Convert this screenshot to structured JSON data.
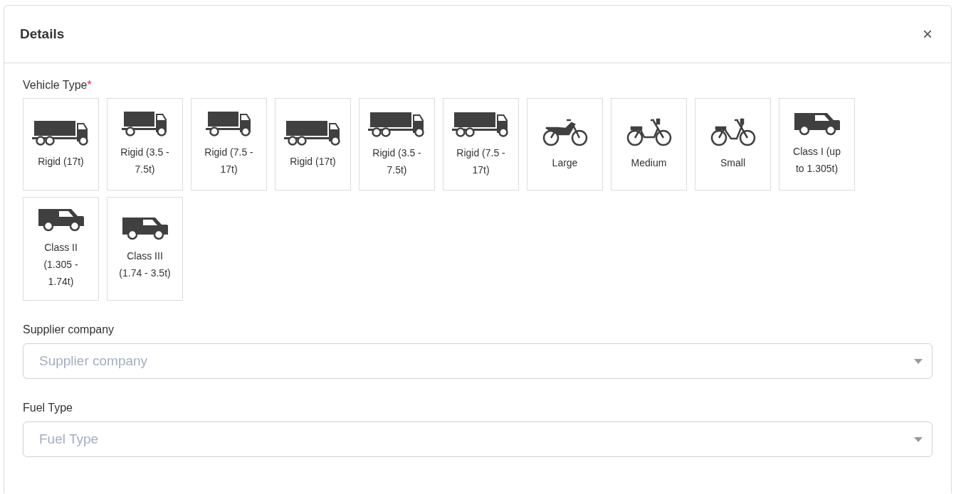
{
  "dialog": {
    "title": "Details",
    "close": "×"
  },
  "vehicle_type": {
    "label": "Vehicle Type",
    "required_mark": "*",
    "options": [
      {
        "kind": "truck-long",
        "label": "Rigid (17t)"
      },
      {
        "kind": "truck-short",
        "label": "Rigid (3.5 - 7.5t)"
      },
      {
        "kind": "truck-short",
        "label": "Rigid (7.5 - 17t)"
      },
      {
        "kind": "truck-long",
        "label": "Rigid (17t)"
      },
      {
        "kind": "truck-long",
        "label": "Rigid (3.5 - 7.5t)"
      },
      {
        "kind": "truck-long",
        "label": "Rigid (7.5 - 17t)"
      },
      {
        "kind": "motorbike",
        "label": "Large"
      },
      {
        "kind": "moped",
        "label": "Medium"
      },
      {
        "kind": "bicycle",
        "label": "Small"
      },
      {
        "kind": "van",
        "label": "Class I (up to 1.305t)"
      },
      {
        "kind": "van",
        "label": "Class II (1.305 - 1.74t)"
      },
      {
        "kind": "van",
        "label": "Class III (1.74 - 3.5t)"
      }
    ]
  },
  "fields": [
    {
      "label": "Supplier company",
      "placeholder": "Supplier company"
    },
    {
      "label": "Fuel Type",
      "placeholder": "Fuel Type"
    }
  ]
}
